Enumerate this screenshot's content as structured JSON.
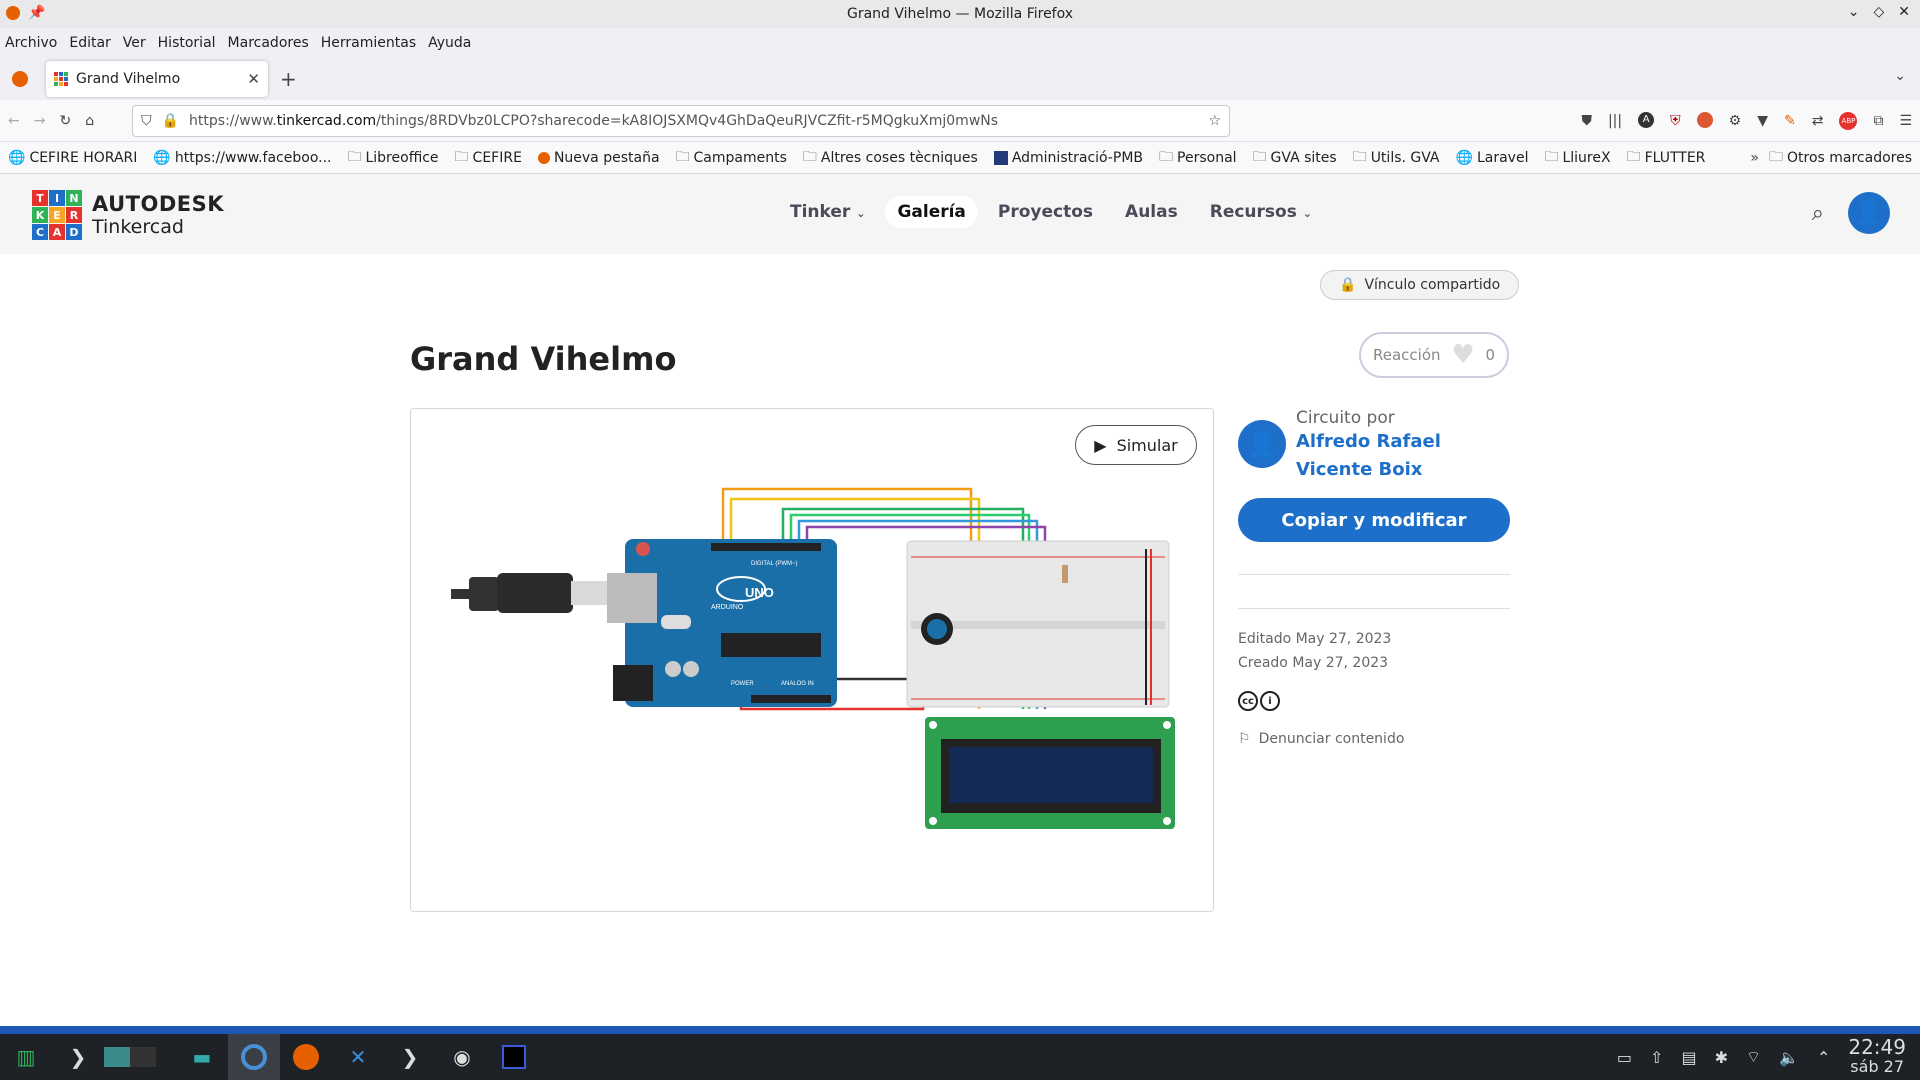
{
  "window": {
    "title": "Grand Vihelmo — Mozilla Firefox"
  },
  "menu": [
    "Archivo",
    "Editar",
    "Ver",
    "Historial",
    "Marcadores",
    "Herramientas",
    "Ayuda"
  ],
  "tab": {
    "title": "Grand Vihelmo"
  },
  "url": {
    "prefix": "https://www.",
    "host": "tinkercad.com",
    "path": "/things/8RDVbz0LCPO?sharecode=kA8IOJSXMQv4GhDaQeuRJVCZfit-r5MQgkuXmj0mwNs"
  },
  "bookmarks": [
    "CEFIRE HORARI",
    "https://www.faceboo...",
    "Libreoffice",
    "CEFIRE",
    "Nueva pestaña",
    "Campaments",
    "Altres coses tècniques",
    "Administració-PMB",
    "Personal",
    "GVA sites",
    "Utils. GVA",
    "Laravel",
    "LliureX",
    "FLUTTER"
  ],
  "bookmarks_other": "Otros marcadores",
  "site": {
    "brand_top": "AUTODESK",
    "brand_bottom": "Tinkercad",
    "logo_letters": [
      "T",
      "I",
      "N",
      "K",
      "E",
      "R",
      "C",
      "A",
      "D"
    ],
    "nav": [
      "Tinker",
      "Galería",
      "Proyectos",
      "Aulas",
      "Recursos"
    ]
  },
  "page": {
    "shared_label": "Vínculo compartido",
    "title": "Grand Vihelmo",
    "reaction_label": "Reacción",
    "reaction_count": "0",
    "simulate_label": "Simular"
  },
  "sidebar": {
    "by_label": "Circuito por",
    "author": "Alfredo Rafael Vicente Boix",
    "copy_label": "Copiar y modificar",
    "edited": "Editado May 27, 2023",
    "created": "Creado May 27, 2023",
    "report_label": "Denunciar contenido"
  },
  "board_labels": {
    "uno": "UNO",
    "arduino": "ARDUINO",
    "digital": "DIGITAL (PWM~)",
    "power": "POWER",
    "analog": "ANALOG IN"
  },
  "clock": {
    "time": "22:49",
    "date": "sáb 27"
  },
  "colors": {
    "accent": "#1d6fc9",
    "taskbar": "#1e2227"
  }
}
